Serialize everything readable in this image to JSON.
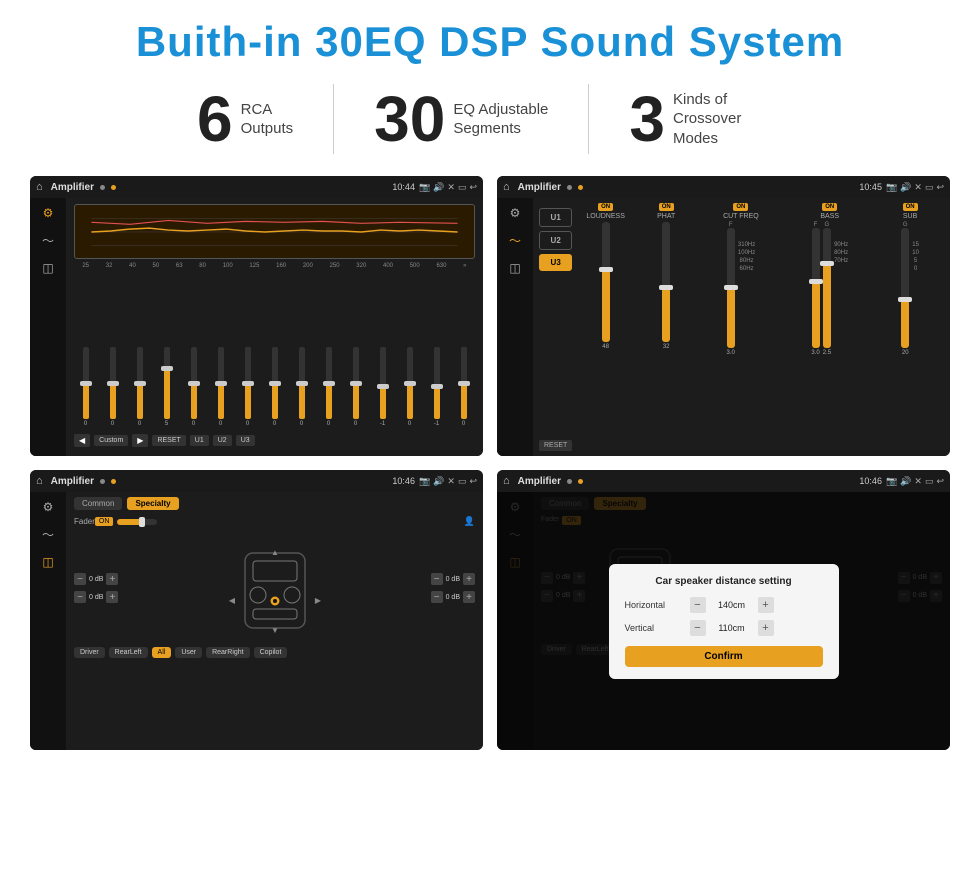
{
  "header": {
    "title": "Buith-in 30EQ DSP Sound System"
  },
  "stats": [
    {
      "number": "6",
      "label": "RCA\nOutputs"
    },
    {
      "number": "30",
      "label": "EQ Adjustable\nSegments"
    },
    {
      "number": "3",
      "label": "Kinds of\nCrossover Modes"
    }
  ],
  "screens": [
    {
      "id": "eq-screen",
      "topbar": {
        "title": "Amplifier",
        "time": "10:44"
      },
      "type": "eq"
    },
    {
      "id": "crossover-screen",
      "topbar": {
        "title": "Amplifier",
        "time": "10:45"
      },
      "type": "crossover"
    },
    {
      "id": "fader-screen",
      "topbar": {
        "title": "Amplifier",
        "time": "10:46"
      },
      "type": "fader"
    },
    {
      "id": "dialog-screen",
      "topbar": {
        "title": "Amplifier",
        "time": "10:46"
      },
      "type": "dialog"
    }
  ],
  "eq": {
    "freqs": [
      "25",
      "32",
      "40",
      "50",
      "63",
      "80",
      "100",
      "125",
      "160",
      "200",
      "250",
      "320",
      "400",
      "500",
      "630"
    ],
    "values": [
      "0",
      "0",
      "0",
      "5",
      "0",
      "0",
      "0",
      "0",
      "0",
      "0",
      "0",
      "-1",
      "0",
      "-1",
      ""
    ],
    "buttons": [
      "Custom",
      "RESET",
      "U1",
      "U2",
      "U3"
    ]
  },
  "crossover": {
    "presets": [
      "U1",
      "U2",
      "U3"
    ],
    "controls": [
      {
        "label": "LOUDNESS",
        "on": true
      },
      {
        "label": "PHAT",
        "on": true
      },
      {
        "label": "CUT FREQ",
        "on": true
      },
      {
        "label": "BASS",
        "on": true
      },
      {
        "label": "SUB",
        "on": true
      }
    ],
    "reset_label": "RESET"
  },
  "fader": {
    "tabs": [
      "Common",
      "Specialty"
    ],
    "active_tab": "Specialty",
    "fader_label": "Fader",
    "fader_on": "ON",
    "db_values": [
      "0 dB",
      "0 dB",
      "0 dB",
      "0 dB"
    ],
    "bottom_btns": [
      "Driver",
      "RearLeft",
      "All",
      "User",
      "RearRight",
      "Copilot"
    ]
  },
  "dialog": {
    "title": "Car speaker distance setting",
    "horizontal_label": "Horizontal",
    "horizontal_value": "140cm",
    "vertical_label": "Vertical",
    "vertical_value": "110cm",
    "confirm_label": "Confirm"
  },
  "colors": {
    "accent": "#e8a020",
    "blue_title": "#1a90d6",
    "dark_bg": "#1c1c1c",
    "screen_border": "#333"
  }
}
